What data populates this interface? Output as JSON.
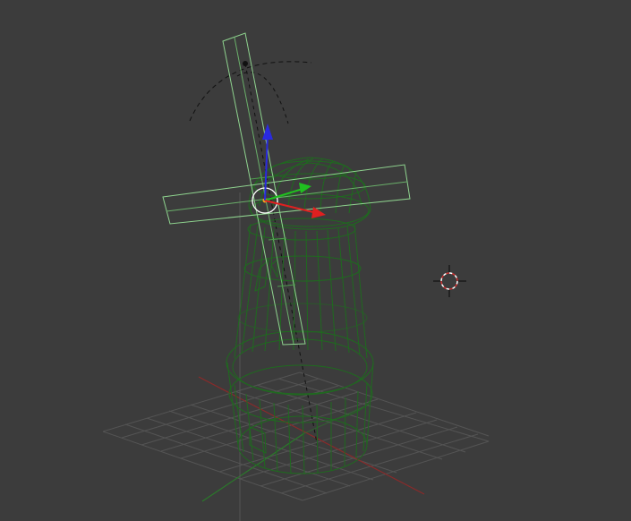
{
  "app": {
    "name": "3D viewport",
    "view": "perspective",
    "shading": "wireframe"
  },
  "scene": {
    "object": {
      "type": "windmill mesh",
      "selected": true,
      "wire_color": "#1e6e1e",
      "selected_outline_color": "#8fd48f"
    },
    "gizmo": {
      "x_axis_color": "#e02020",
      "y_axis_color": "#20c020",
      "z_axis_color": "#2a2ae0"
    },
    "grid": {
      "line_color": "#5a5a5a",
      "x_axis_color": "#8a2a2a",
      "y_axis_color": "#2a7a2a"
    },
    "cursor": {
      "name": "3d-cursor",
      "ring_color_a": "#ffffff",
      "ring_color_b": "#d03030"
    },
    "background_color": "#3c3c3c"
  }
}
